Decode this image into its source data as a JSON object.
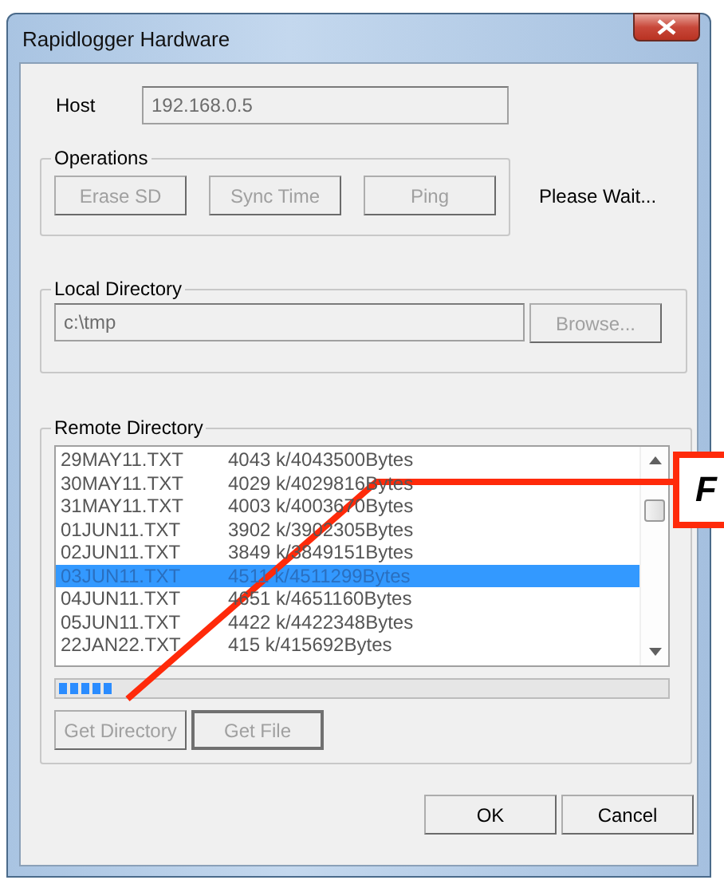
{
  "window": {
    "title": "Rapidlogger Hardware"
  },
  "host": {
    "label": "Host",
    "value": "192.168.0.5"
  },
  "operations": {
    "legend": "Operations",
    "buttons": [
      {
        "label": "Erase SD",
        "disabled": true
      },
      {
        "label": "Sync Time",
        "disabled": true
      },
      {
        "label": "Ping",
        "disabled": true
      }
    ],
    "status": "Please Wait..."
  },
  "local_directory": {
    "legend": "Local Directory",
    "value": "c:\\tmp",
    "button": {
      "label": "Browse...",
      "disabled": true
    }
  },
  "remote_directory": {
    "legend": "Remote Directory",
    "files": [
      {
        "name": "29MAY11.TXT",
        "size": "4043 k/4043500Bytes",
        "selected": false
      },
      {
        "name": "30MAY11.TXT",
        "size": "4029 k/4029816Bytes",
        "selected": false
      },
      {
        "name": "31MAY11.TXT",
        "size": "4003 k/4003670Bytes",
        "selected": false
      },
      {
        "name": "01JUN11.TXT",
        "size": "3902 k/3902305Bytes",
        "selected": false
      },
      {
        "name": "02JUN11.TXT",
        "size": "3849 k/3849151Bytes",
        "selected": false
      },
      {
        "name": "03JUN11.TXT",
        "size": "4511 k/4511299Bytes",
        "selected": true
      },
      {
        "name": "04JUN11.TXT",
        "size": "4651 k/4651160Bytes",
        "selected": false
      },
      {
        "name": "05JUN11.TXT",
        "size": "4422 k/4422348Bytes",
        "selected": false
      },
      {
        "name": "22JAN22.TXT",
        "size": "415 k/415692Bytes",
        "selected": false
      }
    ],
    "buttons": [
      {
        "label": "Get Directory",
        "disabled": true
      },
      {
        "label": "Get File",
        "disabled": true
      }
    ]
  },
  "dialog_buttons": [
    {
      "label": "OK",
      "disabled": false
    },
    {
      "label": "Cancel",
      "disabled": false
    }
  ],
  "callout": {
    "label": "F"
  }
}
